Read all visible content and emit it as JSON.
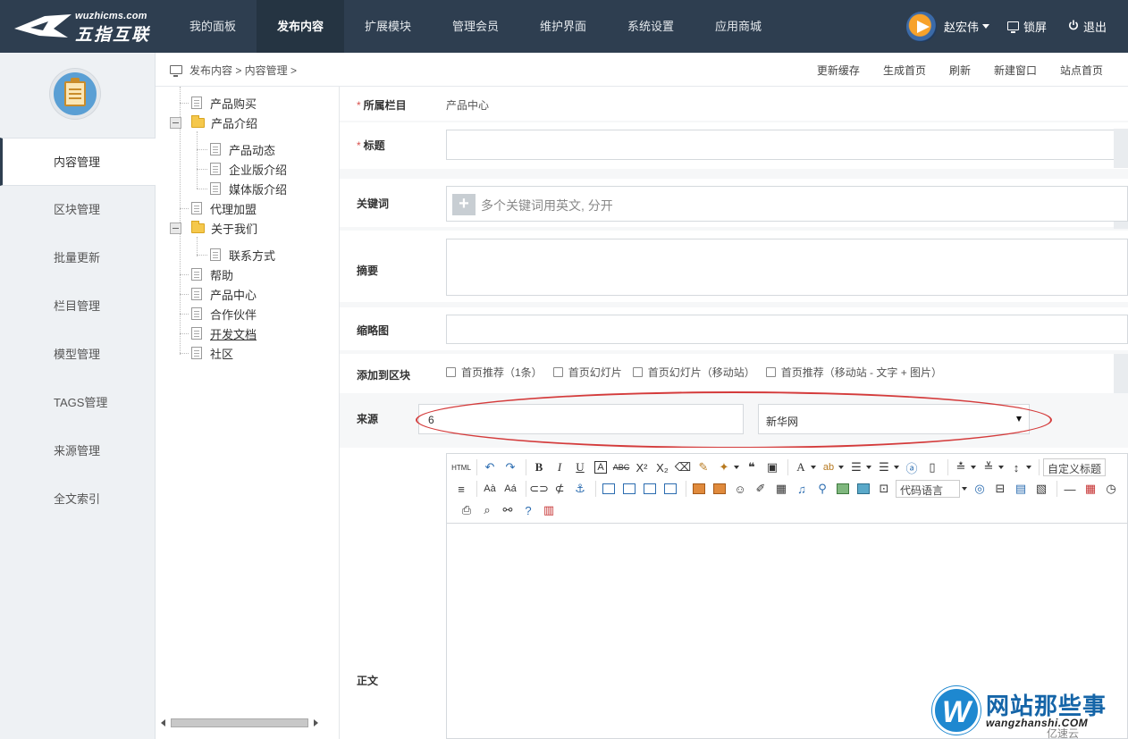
{
  "header": {
    "logo_sub": "wuzhicms.com",
    "logo_main": "五指互联",
    "nav": [
      "我的面板",
      "发布内容",
      "扩展模块",
      "管理会员",
      "维护界面",
      "系统设置",
      "应用商城"
    ],
    "active_nav_index": 1,
    "user_name": "赵宏伟",
    "lock_label": "锁屏",
    "logout_label": "退出"
  },
  "sidebar": {
    "items": [
      "内容管理",
      "区块管理",
      "批量更新",
      "栏目管理",
      "模型管理",
      "TAGS管理",
      "来源管理",
      "全文索引"
    ],
    "active_index": 0
  },
  "breadcrumb": {
    "text": "发布内容 > 内容管理 >"
  },
  "quick_links": [
    "更新缓存",
    "生成首页",
    "刷新",
    "新建窗口",
    "站点首页"
  ],
  "tree": [
    {
      "label": "产品购买",
      "type": "doc",
      "level": 0
    },
    {
      "label": "产品介绍",
      "type": "folder",
      "level": 0
    },
    {
      "label": "产品动态",
      "type": "doc",
      "level": 1
    },
    {
      "label": "企业版介绍",
      "type": "doc",
      "level": 1
    },
    {
      "label": "媒体版介绍",
      "type": "doc",
      "level": 1
    },
    {
      "label": "代理加盟",
      "type": "doc",
      "level": 0
    },
    {
      "label": "关于我们",
      "type": "folder",
      "level": 0
    },
    {
      "label": "联系方式",
      "type": "doc",
      "level": 1
    },
    {
      "label": "帮助",
      "type": "doc",
      "level": 0
    },
    {
      "label": "产品中心",
      "type": "doc",
      "level": 0
    },
    {
      "label": "合作伙伴",
      "type": "doc",
      "level": 0
    },
    {
      "label": "开发文档",
      "type": "doc",
      "level": 0
    },
    {
      "label": "社区",
      "type": "doc",
      "level": 0
    }
  ],
  "form": {
    "category_label": "所属栏目",
    "category_value": "产品中心",
    "title_label": "标题",
    "title_value": "",
    "keywords_label": "关键词",
    "keywords_placeholder": "多个关键词用英文, 分开",
    "summary_label": "摘要",
    "thumb_label": "缩略图",
    "block_label": "添加到区块",
    "block_options": [
      "首页推荐（1条）",
      "首页幻灯片",
      "首页幻灯片（移动站）",
      "首页推荐（移动站 - 文字 + 图片）"
    ],
    "source_label": "来源",
    "source_value": "6",
    "source_select_value": "新华网",
    "body_label": "正文"
  },
  "editor": {
    "html_label": "HTML",
    "code_lang": "代码语言",
    "custom_title": "自定义标题"
  },
  "watermark": {
    "title": "网站那些事",
    "sub": "wangzhanshi.COM",
    "yisu": "亿速云",
    "letter": "W"
  },
  "colors": {
    "topbar": "#2e3e50",
    "accent_red": "#d43b3b"
  }
}
